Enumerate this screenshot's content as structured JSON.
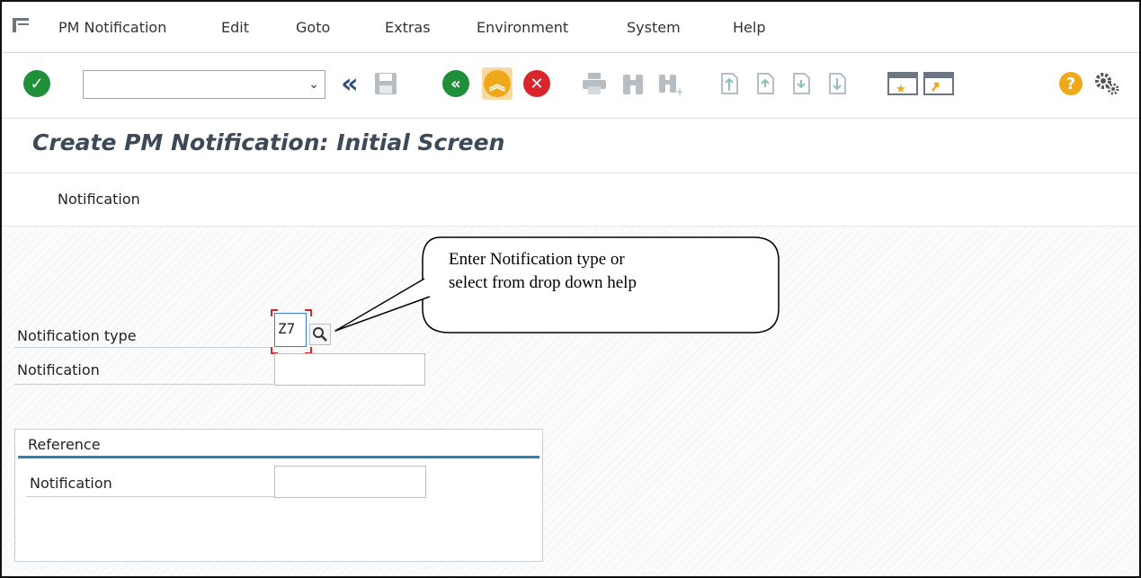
{
  "menu": {
    "items": [
      "PM Notification",
      "Edit",
      "Goto",
      "Extras",
      "Environment",
      "System",
      "Help"
    ]
  },
  "toolbar": {
    "command_field_value": "",
    "icons": [
      "enter-icon",
      "back-double-chevron-icon",
      "save-icon",
      "back-icon",
      "exit-icon",
      "cancel-icon",
      "print-icon",
      "find-icon",
      "find-next-icon",
      "first-page-icon",
      "previous-page-icon",
      "next-page-icon",
      "last-page-icon",
      "create-session-icon",
      "shortcut-icon",
      "help-icon",
      "customize-layout-icon"
    ]
  },
  "title": "Create PM Notification: Initial Screen",
  "toolline": {
    "notification_button": "Notification"
  },
  "form": {
    "notification_type_label": "Notification type",
    "notification_type_value": "Z7",
    "notification_label": "Notification",
    "notification_value": ""
  },
  "reference": {
    "title": "Reference",
    "notification_label": "Notification",
    "notification_value": ""
  },
  "callout": {
    "line1": "Enter Notification type or",
    "line2": "select from drop down help"
  },
  "colors": {
    "title": "#3c4a58",
    "accent_blue": "#2c7fb8",
    "enter_green": "#1f8f3a",
    "cancel_red": "#d8262d",
    "orange": "#f0a81b"
  }
}
